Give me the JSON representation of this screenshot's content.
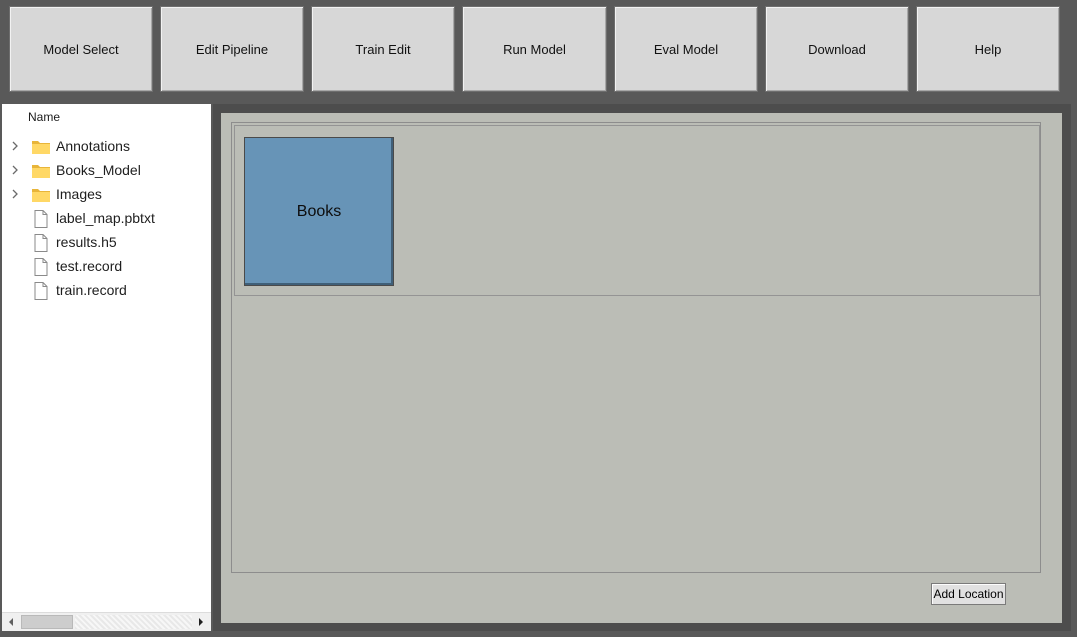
{
  "toolbar": {
    "buttons": [
      {
        "label": "Model Select"
      },
      {
        "label": "Edit Pipeline"
      },
      {
        "label": "Train Edit"
      },
      {
        "label": "Run Model"
      },
      {
        "label": "Eval Model"
      },
      {
        "label": "Download"
      },
      {
        "label": "Help"
      }
    ]
  },
  "tree": {
    "header": "Name",
    "items": [
      {
        "label": "Annotations",
        "type": "folder",
        "icon": "folder-icon"
      },
      {
        "label": "Books_Model",
        "type": "folder",
        "icon": "folder-icon"
      },
      {
        "label": "Images",
        "type": "folder",
        "icon": "folder-icon"
      },
      {
        "label": "label_map.pbtxt",
        "type": "file",
        "icon": "file-icon"
      },
      {
        "label": "results.h5",
        "type": "file",
        "icon": "file-icon"
      },
      {
        "label": "test.record",
        "type": "file",
        "icon": "file-icon"
      },
      {
        "label": "train.record",
        "type": "file",
        "icon": "file-icon"
      }
    ]
  },
  "main": {
    "locations": [
      {
        "label": "Books"
      }
    ],
    "add_location_label": "Add Location"
  },
  "colors": {
    "toolbar_bg": "#595959",
    "button_bg": "#d7d7d7",
    "panel_bg": "#bbbdb6",
    "tile_bg": "#6794b7"
  }
}
